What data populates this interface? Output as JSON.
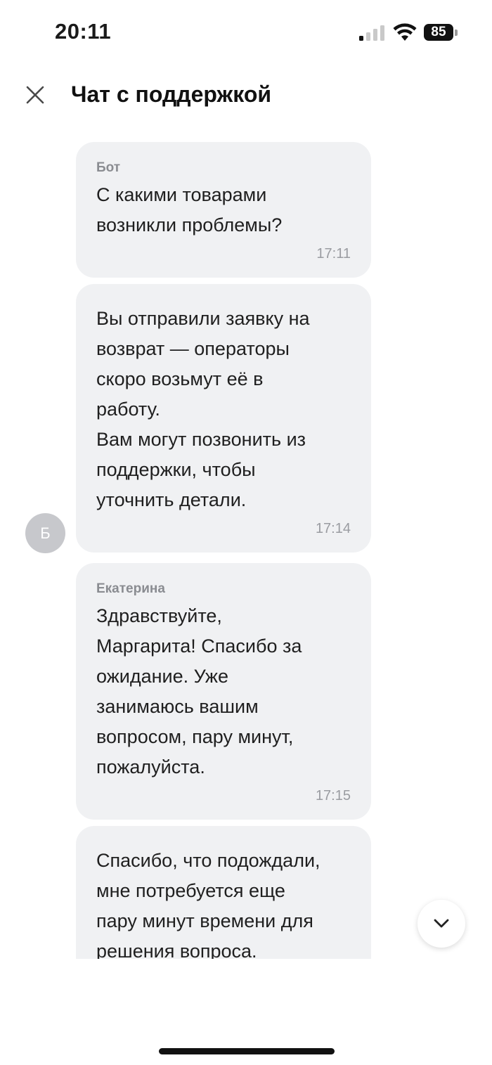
{
  "status_bar": {
    "time": "20:11",
    "battery_level": "85",
    "icons": [
      "signal-icon",
      "wifi-icon",
      "battery-icon"
    ]
  },
  "header": {
    "title": "Чат с поддержкой",
    "close_icon": "close-icon"
  },
  "messages": [
    {
      "author": "Бот",
      "text": "С какими товарами\nвозникли проблемы?",
      "time": "17:11"
    },
    {
      "author": "",
      "text": "Вы отправили заявку на\nвозврат — операторы\nскоро возьмут её в\nработу.\nВам могут позвонить из\nподдержки, чтобы\nуточнить детали.",
      "time": "17:14"
    },
    {
      "author": "Екатерина",
      "text": "Здравствуйте,\nМаргарита! Спасибо за\nожидание. Уже\nзанимаюсь вашим\nвопросом, пару минут,\nпожалуйста.",
      "time": "17:15"
    },
    {
      "author": "",
      "text": "Спасибо, что подождали,\nмне потребуется еще\nпару минут времени для\nрешения вопроса.",
      "time": ""
    }
  ],
  "avatar": {
    "initial": "Б"
  },
  "scroll_down_button": {
    "icon": "chevron-down-icon"
  }
}
